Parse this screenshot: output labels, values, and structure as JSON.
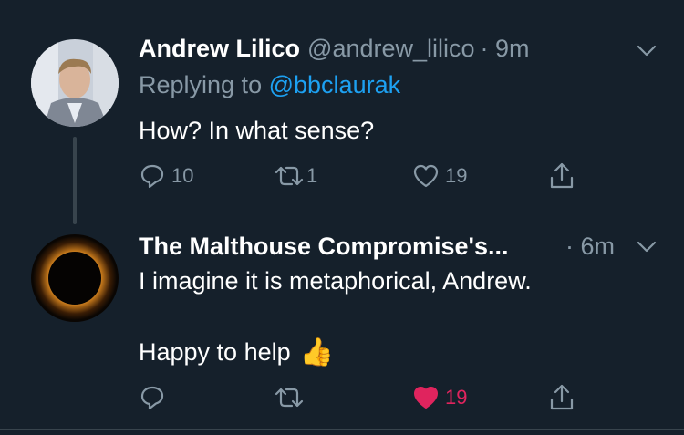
{
  "tweets": [
    {
      "name": "Andrew Lilico",
      "handle": "@andrew_lilico",
      "time": "· 9m",
      "replying_prefix": "Replying to",
      "replying_to": "@bbclaurak",
      "text": "How? In what sense?",
      "actions": {
        "reply_count": "10",
        "retweet_count": "1",
        "like_count": "19"
      }
    },
    {
      "name": "The Malthouse Compromise's...",
      "time": "· 6m",
      "text_line1": "I imagine it is metaphorical, Andrew.",
      "text_line2": "Happy to help",
      "emoji": "👍",
      "actions": {
        "reply_count": "",
        "retweet_count": "",
        "like_count": "19",
        "liked": true
      }
    }
  ],
  "colors": {
    "background": "#15202b",
    "secondary_text": "#8899a6",
    "link": "#1da1f2",
    "like_active": "#e0245e",
    "divider": "#38444d"
  },
  "icons": [
    "chevron-down-icon",
    "reply-icon",
    "retweet-icon",
    "like-icon",
    "share-icon"
  ]
}
